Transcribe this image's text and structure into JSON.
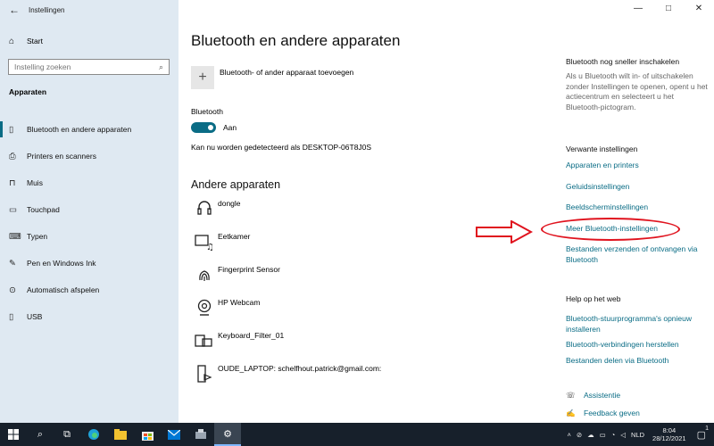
{
  "window": {
    "app_title": "Instellingen",
    "back_icon": "back-arrow-icon",
    "controls": [
      "—",
      "□",
      "✕"
    ]
  },
  "sidebar": {
    "home_label": "Start",
    "search_placeholder": "Instelling zoeken",
    "section": "Apparaten",
    "items": [
      {
        "label": "Bluetooth en andere apparaten",
        "icon": "bluetooth-icon",
        "active": true
      },
      {
        "label": "Printers en scanners",
        "icon": "printer-icon"
      },
      {
        "label": "Muis",
        "icon": "mouse-icon"
      },
      {
        "label": "Touchpad",
        "icon": "touchpad-icon"
      },
      {
        "label": "Typen",
        "icon": "keyboard-icon"
      },
      {
        "label": "Pen en Windows Ink",
        "icon": "pen-icon"
      },
      {
        "label": "Automatisch afspelen",
        "icon": "autoplay-icon"
      },
      {
        "label": "USB",
        "icon": "usb-icon"
      }
    ]
  },
  "main": {
    "title": "Bluetooth en andere apparaten",
    "add_device_label": "Bluetooth- of ander apparaat toevoegen",
    "bluetooth_label": "Bluetooth",
    "bluetooth_state": "Aan",
    "discover_text": "Kan nu worden gedetecteerd als DESKTOP-06T8J0S",
    "other_devices_title": "Andere apparaten",
    "devices": [
      {
        "name": "dongle",
        "icon": "headset-icon"
      },
      {
        "name": "Eetkamer",
        "icon": "media-device-icon"
      },
      {
        "name": "Fingerprint Sensor",
        "icon": "fingerprint-icon"
      },
      {
        "name": "HP Webcam",
        "icon": "webcam-icon"
      },
      {
        "name": "Keyboard_Filter_01",
        "icon": "generic-device-icon"
      },
      {
        "name": "OUDE_LAPTOP: schelfhout.patrick@gmail.com:",
        "icon": "media-server-icon"
      }
    ]
  },
  "right": {
    "quick_title": "Bluetooth nog sneller inschakelen",
    "quick_text": "Als u Bluetooth wilt in- of uitschakelen zonder Instellingen te openen, opent u het actiecentrum en selecteert u het Bluetooth-pictogram.",
    "related_title": "Verwante instellingen",
    "related_links": [
      "Apparaten en printers",
      "Geluidsinstellingen",
      "Beeldscherminstellingen",
      "Meer Bluetooth-instellingen",
      "Bestanden verzenden of ontvangen via Bluetooth"
    ],
    "help_title": "Help op het web",
    "help_links": [
      "Bluetooth-stuurprogramma's opnieuw installeren",
      "Bluetooth-verbindingen herstellen",
      "Bestanden delen via Bluetooth"
    ],
    "assist_label": "Assistentie",
    "feedback_label": "Feedback geven"
  },
  "annotation": {
    "highlight_color": "#e0131e"
  },
  "taskbar": {
    "language": "NLD",
    "time": "8:04",
    "date": "28/12/2021",
    "notification_count": "1"
  }
}
